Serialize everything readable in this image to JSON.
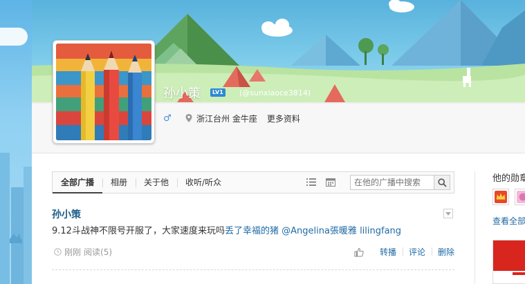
{
  "profile": {
    "name": "孙小策",
    "level": "LV1",
    "handle": "(@sunxiaoce3814)",
    "gender_icon": "male-icon",
    "location": "浙江台州 金牛座",
    "more_info": "更多资料"
  },
  "tabs": [
    {
      "label": "全部广播",
      "active": true
    },
    {
      "label": "相册"
    },
    {
      "label": "关于他"
    },
    {
      "label": "收听/听众"
    }
  ],
  "search": {
    "placeholder": "在他的广播中搜索"
  },
  "post": {
    "author": "孙小策",
    "text": "9.12斗战神不限号开服了，大家速度来玩吗",
    "mentions": [
      "丢了幸福的猪",
      "@Angelina張暖雅",
      "lilingfang"
    ],
    "time": "刚刚",
    "reads": "阅读(5)",
    "actions": {
      "repost": "转播",
      "comment": "评论",
      "delete": "删除"
    }
  },
  "sidebar": {
    "title": "他的勋章",
    "view_all": "查看全部"
  },
  "colors": {
    "link": "#1f6aa5",
    "author": "#1a5a86",
    "sky": "#7ccbea",
    "grass": "#b9e3a0"
  }
}
